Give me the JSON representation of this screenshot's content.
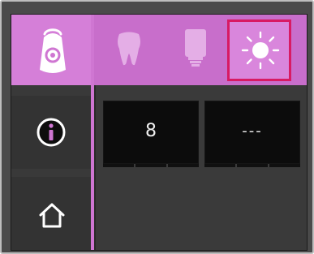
{
  "sidebar": {
    "items": [
      {
        "id": "device",
        "icon": "curing-light-device-icon",
        "active": true
      },
      {
        "id": "info",
        "icon": "info-icon",
        "active": false
      },
      {
        "id": "home",
        "icon": "home-icon",
        "active": false
      }
    ]
  },
  "mode_tabs": [
    {
      "id": "tooth",
      "icon": "tooth-icon",
      "active": false
    },
    {
      "id": "material",
      "icon": "material-tube-icon",
      "active": false
    },
    {
      "id": "light",
      "icon": "light-sun-icon",
      "active": true
    }
  ],
  "displays": [
    {
      "value": "8"
    },
    {
      "value": "---"
    }
  ],
  "colors": {
    "accent": "#cf76d2",
    "active_tab_bg": "#d986dc",
    "selection_border": "#d81a63",
    "display_bg": "#0c0c0c"
  }
}
